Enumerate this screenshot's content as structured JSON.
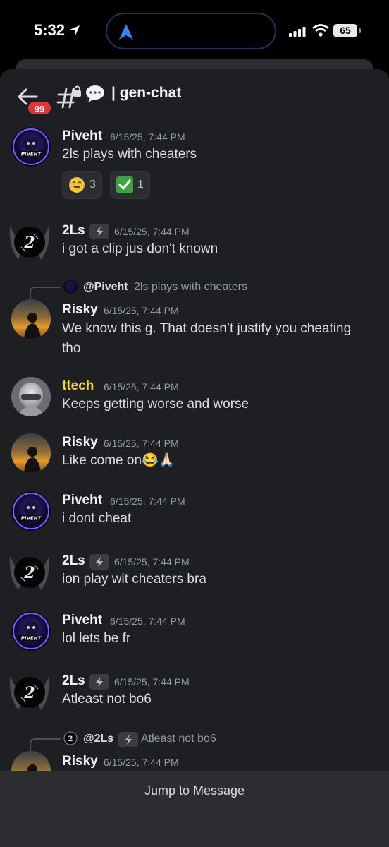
{
  "status_bar": {
    "time": "5:32",
    "battery": "65"
  },
  "header": {
    "unread_badge": "99",
    "channel_name": "| gen-chat"
  },
  "messages": [
    {
      "author": "Piveht",
      "timestamp": "6/15/25, 7:44 PM",
      "content": "2ls plays with cheaters",
      "reactions": [
        {
          "emoji": "laughing-tears",
          "count": "3"
        },
        {
          "emoji": "check-mark",
          "count": "1"
        }
      ]
    },
    {
      "author": "2Ls",
      "timestamp": "6/15/25, 7:44 PM",
      "content": "i got a clip jus don't known"
    },
    {
      "reply_to": {
        "author": "@Piveht",
        "text": "2ls plays with cheaters"
      },
      "author": "Risky",
      "timestamp": "6/15/25, 7:44 PM",
      "content": "We know this g. That doesn’t justify you cheating tho"
    },
    {
      "author": "ttech",
      "timestamp": "6/15/25, 7:44 PM",
      "content": "Keeps getting worse and worse",
      "author_color": "#f0d43a"
    },
    {
      "author": "Risky",
      "timestamp": "6/15/25, 7:44 PM",
      "content": "Like come on😂🙏🏻"
    },
    {
      "author": "Piveht",
      "timestamp": "6/15/25, 7:44 PM",
      "content": "i dont cheat"
    },
    {
      "author": "2Ls",
      "timestamp": "6/15/25, 7:44 PM",
      "content": "ion play wit cheaters bra"
    },
    {
      "author": "Piveht",
      "timestamp": "6/15/25, 7:44 PM",
      "content": "lol lets be fr"
    },
    {
      "author": "2Ls",
      "timestamp": "6/15/25, 7:44 PM",
      "content": "Atleast not bo6"
    },
    {
      "reply_to": {
        "author": "@2Ls",
        "text": "Atleast not bo6"
      },
      "author": "Risky",
      "timestamp": "6/15/25, 7:44 PM"
    }
  ],
  "jump_bar": {
    "label": "Jump to Message"
  },
  "colors": {
    "background": "#1e1f22",
    "header_bg": "#1e1f22",
    "badge": "#da373c",
    "timestamp": "#949ba4",
    "role_yellow": "#f0d43a"
  }
}
